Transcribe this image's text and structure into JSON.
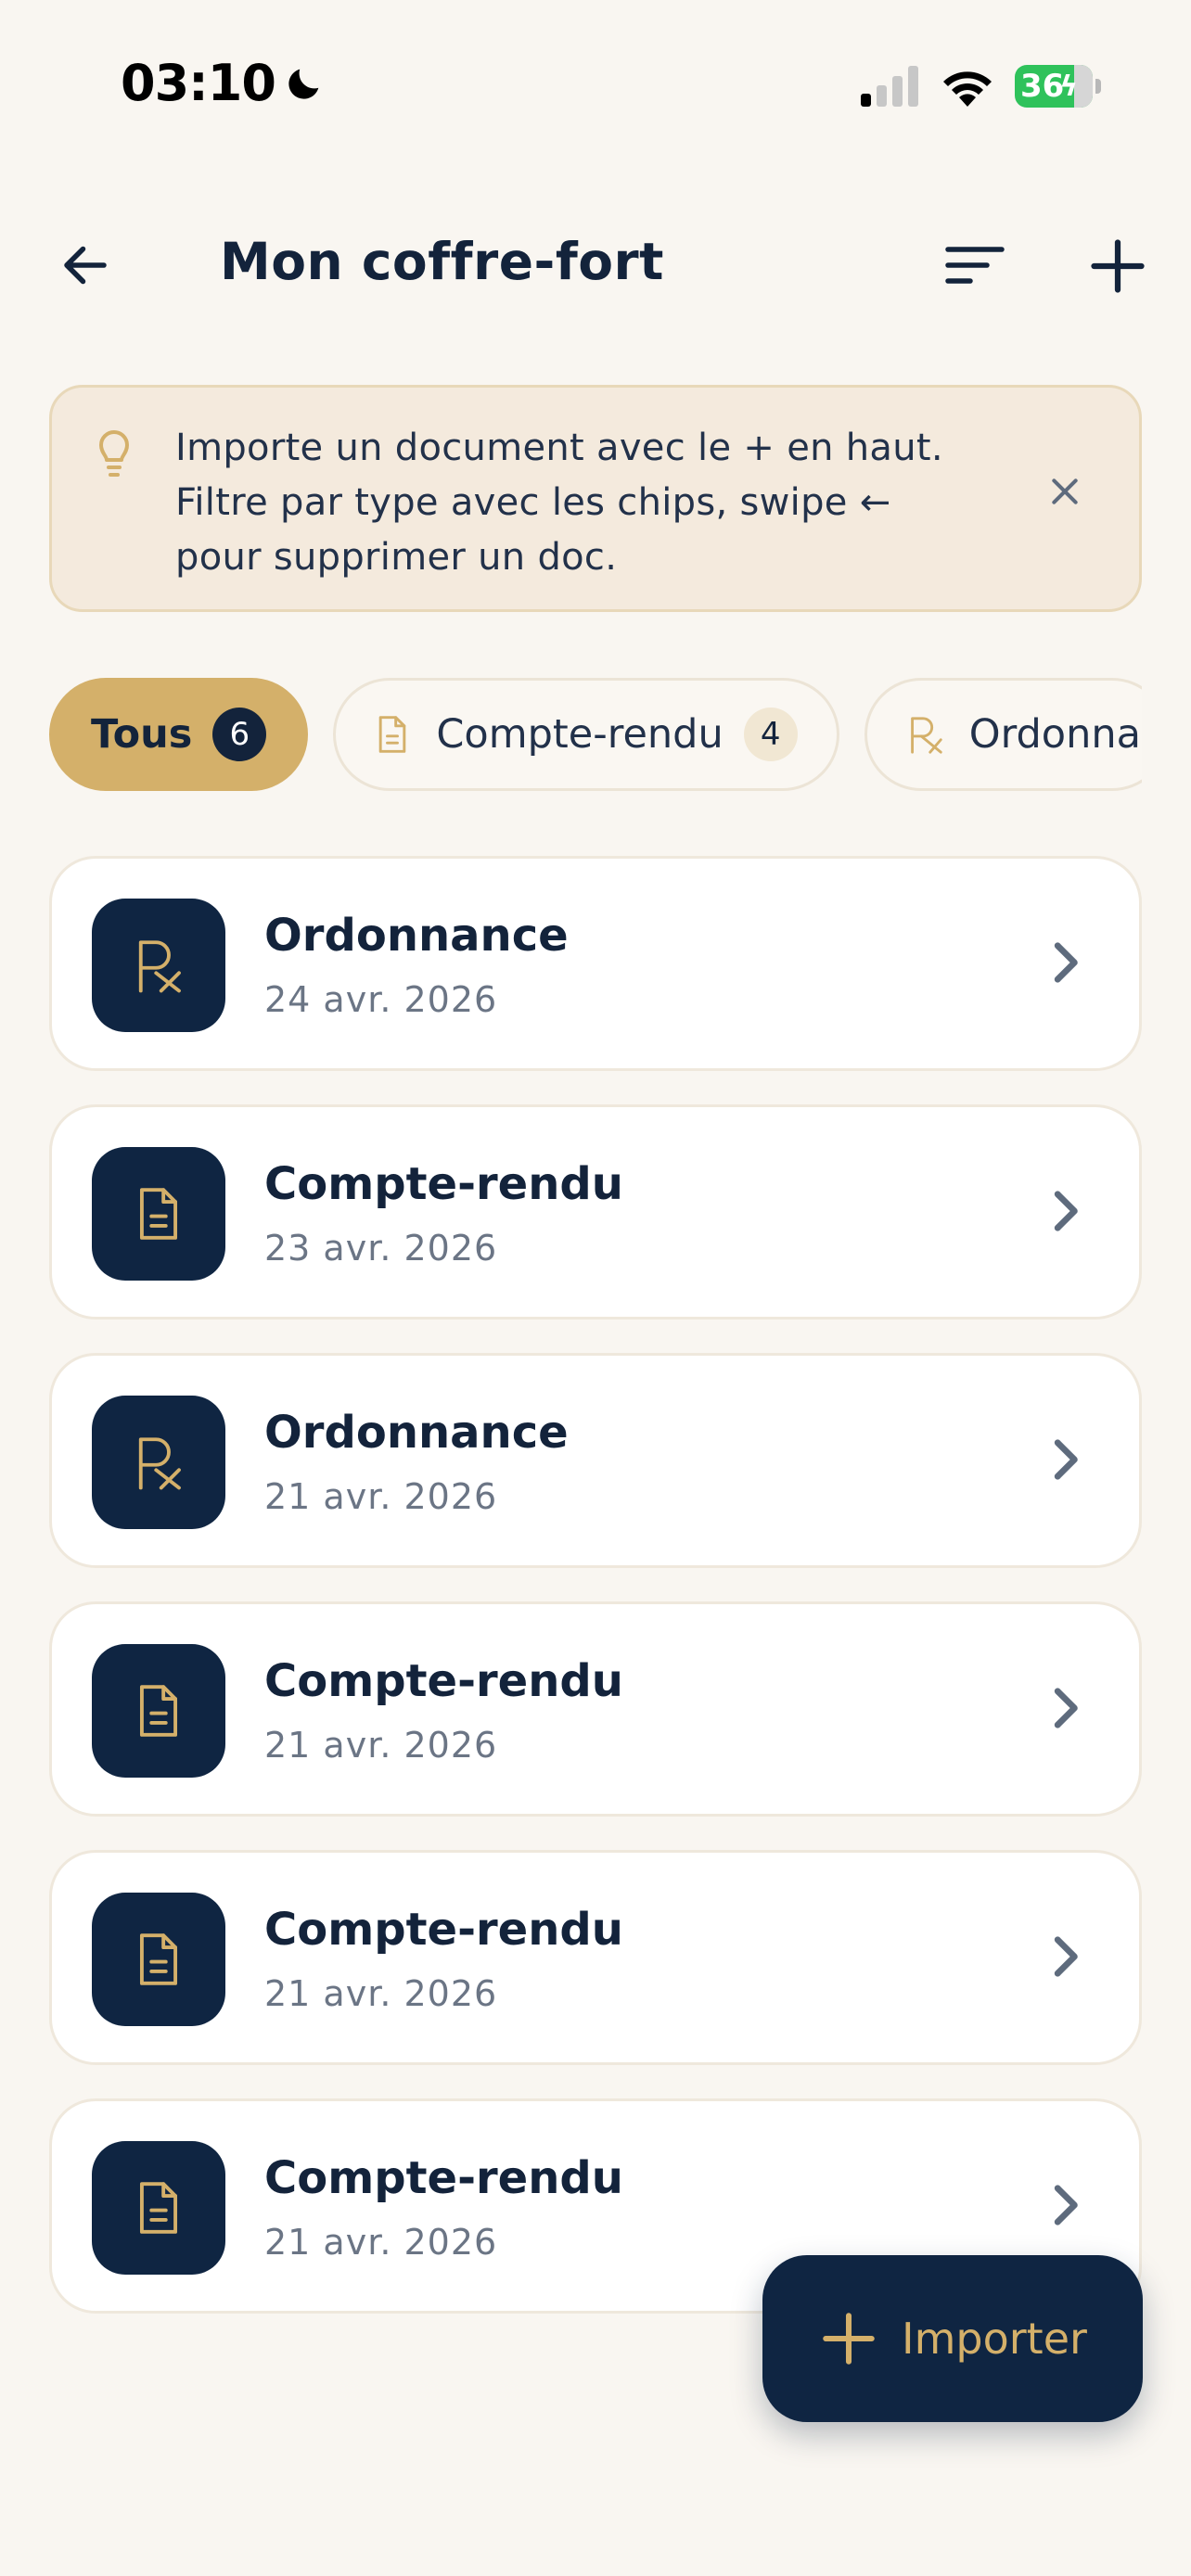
{
  "status_bar": {
    "time": "03:10",
    "battery": "36"
  },
  "header": {
    "title": "Mon coffre-fort"
  },
  "tip": {
    "line1": "Importe un document avec le + en haut.",
    "line2": "Filtre par type avec les chips, swipe ←",
    "line3": "pour supprimer un doc."
  },
  "chips": [
    {
      "label": "Tous",
      "count": "6",
      "selected": true
    },
    {
      "label": "Compte-rendu",
      "count": "4",
      "icon": "document-icon"
    },
    {
      "label": "Ordonnan",
      "icon": "prescription-icon"
    }
  ],
  "documents": [
    {
      "title": "Ordonnance",
      "date": "24 avr. 2026",
      "icon": "prescription-icon"
    },
    {
      "title": "Compte-rendu",
      "date": "23 avr. 2026",
      "icon": "document-icon"
    },
    {
      "title": "Ordonnance",
      "date": "21 avr. 2026",
      "icon": "prescription-icon"
    },
    {
      "title": "Compte-rendu",
      "date": "21 avr. 2026",
      "icon": "document-icon"
    },
    {
      "title": "Compte-rendu",
      "date": "21 avr. 2026",
      "icon": "document-icon"
    },
    {
      "title": "Compte-rendu",
      "date": "21 avr. 2026",
      "icon": "document-icon"
    }
  ],
  "fab": {
    "label": "Importer"
  },
  "colors": {
    "navy": "#0f2542",
    "gold": "#d4b06a",
    "background": "#f9f6f1"
  }
}
